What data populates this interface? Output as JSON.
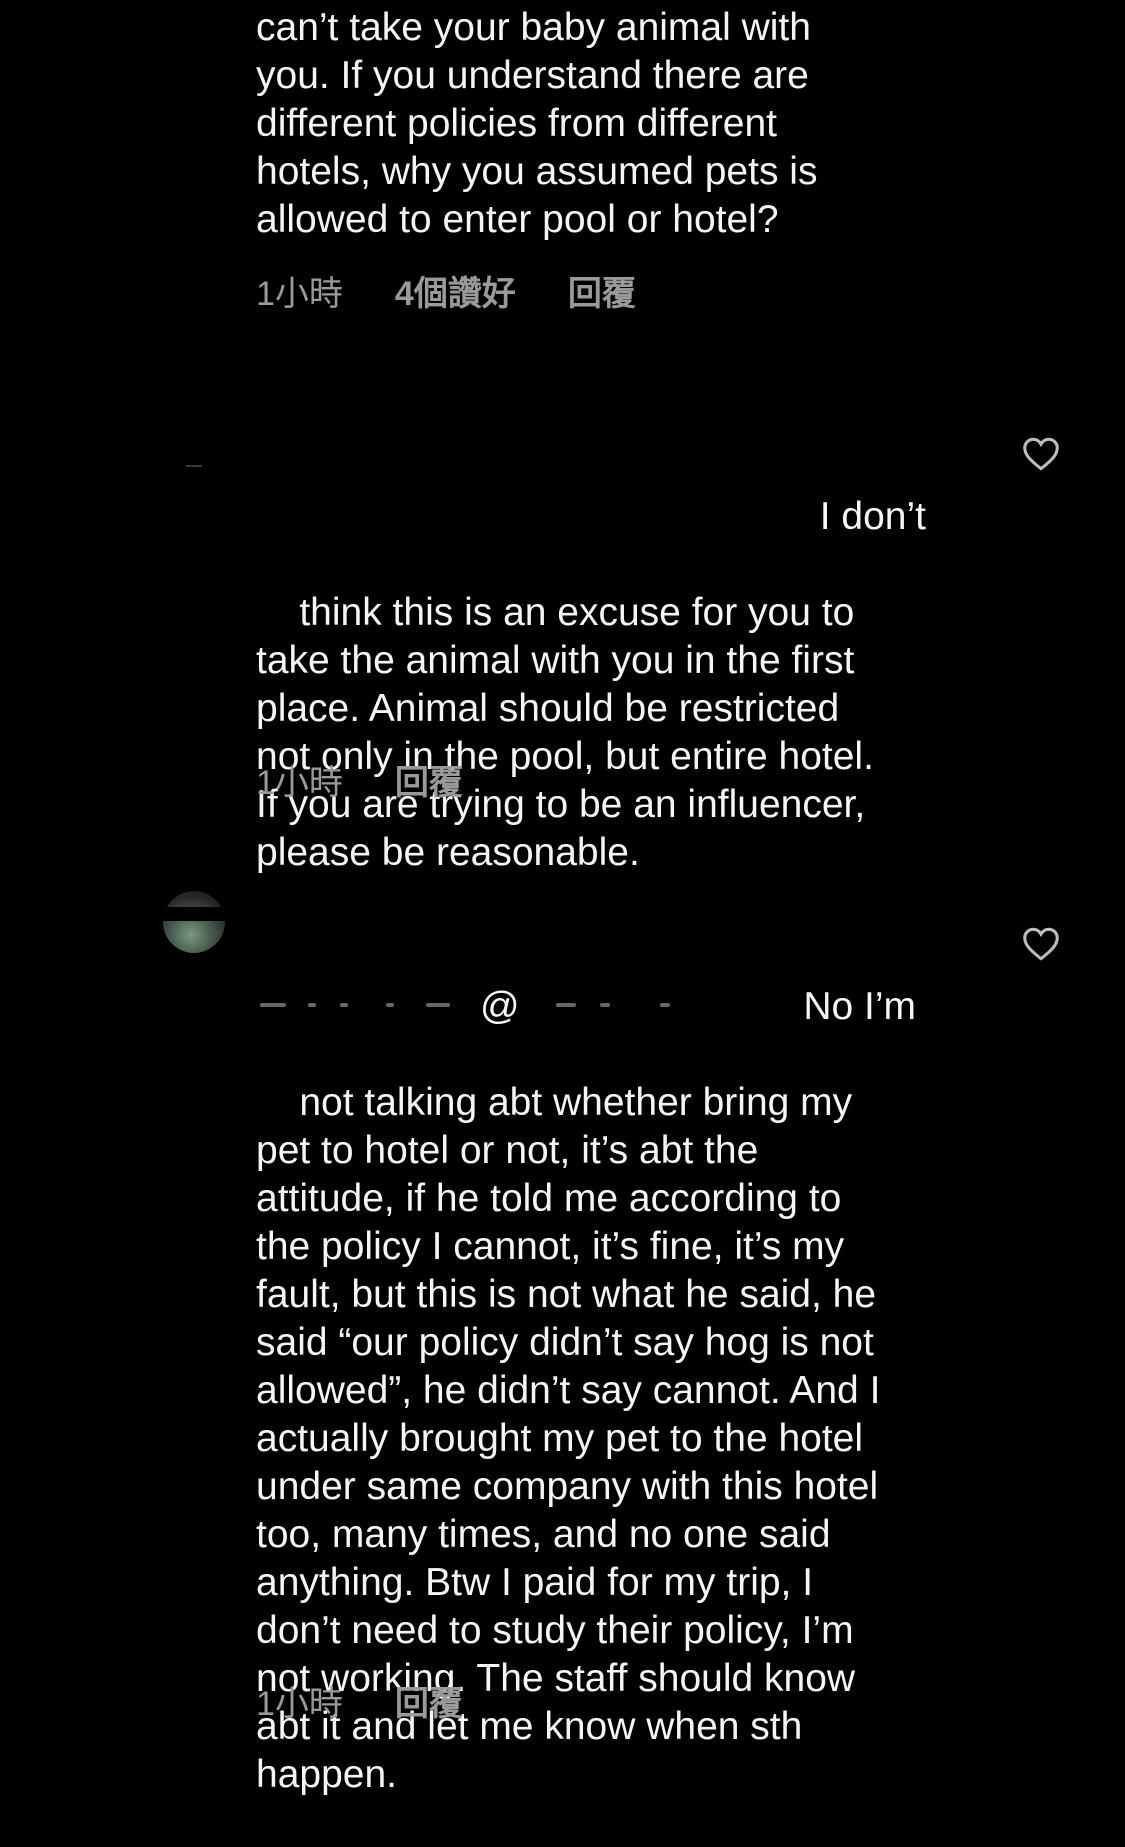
{
  "comments": [
    {
      "text": "can’t take your baby animal with\nyou. If you understand there are\ndifferent policies from different\nhotels, why you assumed pets is\nallowed to enter pool or hotel?",
      "time": "1小時",
      "likes": "4個讚好",
      "reply_label": "回覆"
    },
    {
      "first_line_tail": "I don’t",
      "text": "think this is an excuse for you to\ntake the animal with you in the first\nplace. Animal should be restricted\nnot only in the pool, but entire hotel.\nIf you are trying to be an influencer,\nplease be reasonable.",
      "time": "1小時",
      "reply_label": "回覆"
    },
    {
      "mention_symbol": "@",
      "first_line_tail": "No I’m",
      "text": "not talking abt whether bring my\npet to hotel or not, it’s abt the\nattitude, if he told me according to\nthe policy I cannot, it’s fine, it’s my\nfault, but this is not what he said, he\nsaid “our policy didn’t say hog is not\nallowed”, he didn’t say cannot. And I\nactually brought my pet to the hotel\nunder same company with this hotel\ntoo, many times, and no one said\nanything. Btw I paid for my trip, I\ndon’t need to study their policy, I’m\nnot working. The staff should know\nabt it and let me know when sth\nhappen.",
      "time": "1小時",
      "reply_label": "回覆"
    }
  ],
  "icons": {
    "like": "heart-outline-icon"
  },
  "colors": {
    "background": "#000000",
    "text": "#f5f5f5",
    "meta": "#9a9a9a"
  }
}
